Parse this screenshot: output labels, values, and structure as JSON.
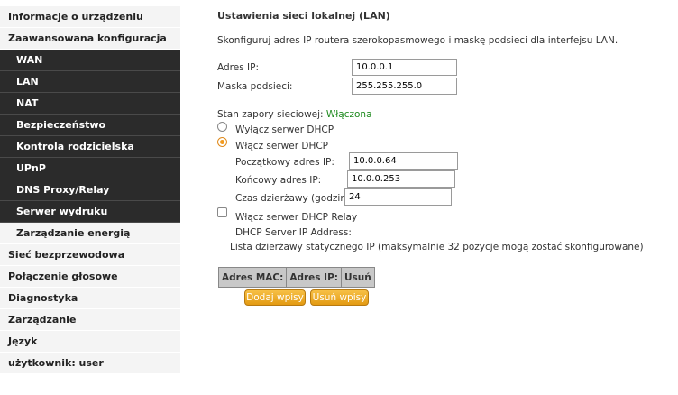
{
  "sidebar": {
    "items": [
      {
        "label": "Informacje o urządzeniu",
        "style": "light"
      },
      {
        "label": "Zaawansowana konfiguracja",
        "style": "light"
      },
      {
        "label": "WAN",
        "style": "dark"
      },
      {
        "label": "LAN",
        "style": "dark"
      },
      {
        "label": "NAT",
        "style": "dark"
      },
      {
        "label": "Bezpieczeństwo",
        "style": "dark"
      },
      {
        "label": "Kontrola rodzicielska",
        "style": "dark"
      },
      {
        "label": "UPnP",
        "style": "dark"
      },
      {
        "label": "DNS Proxy/Relay",
        "style": "dark"
      },
      {
        "label": "Serwer wydruku",
        "style": "dark"
      },
      {
        "label": "Zarządzanie energią",
        "style": "sub"
      },
      {
        "label": "Sieć bezprzewodowa",
        "style": "light"
      },
      {
        "label": "Połączenie głosowe",
        "style": "light"
      },
      {
        "label": "Diagnostyka",
        "style": "light"
      },
      {
        "label": "Zarządzanie",
        "style": "light"
      },
      {
        "label": "Język",
        "style": "light"
      },
      {
        "label": "użytkownik: user",
        "style": "light"
      }
    ]
  },
  "main": {
    "title": "Ustawienia sieci lokalnej (LAN)",
    "description": "Skonfiguruj adres IP routera szerokopasmowego i maskę podsieci dla interfejsu LAN.",
    "ip_label": "Adres IP:",
    "ip_value": "10.0.0.1",
    "mask_label": "Maska podsieci:",
    "mask_value": "255.255.255.0",
    "firewall_label": "Stan zapory sieciowej:",
    "firewall_value": "Włączona",
    "dhcp_disable_label": "Wyłącz serwer DHCP",
    "dhcp_enable_label": "Włącz serwer DHCP",
    "start_ip_label": "Początkowy adres IP:",
    "start_ip_value": "10.0.0.64",
    "end_ip_label": "Końcowy adres IP:",
    "end_ip_value": "10.0.0.253",
    "lease_label": "Czas dzierżawy (godzina):",
    "lease_value": "24",
    "relay_label": "Włącz serwer DHCP Relay",
    "relay_ip_label": "DHCP Server IP Address:",
    "static_lease_text": "Lista dzierżawy statycznego IP (maksymalnie 32 pozycje mogą zostać skonfigurowane)",
    "table_headers": [
      "Adres MAC:",
      "Adres IP:",
      "Usuń"
    ],
    "add_button": "Dodaj wpisy",
    "remove_button": "Usuń wpisy"
  },
  "colors": {
    "sidebar_dark": "#2b2b2b",
    "sidebar_light": "#f4f4f4",
    "status_green": "#1e8a1e",
    "button_orange": "#e9a21c"
  }
}
